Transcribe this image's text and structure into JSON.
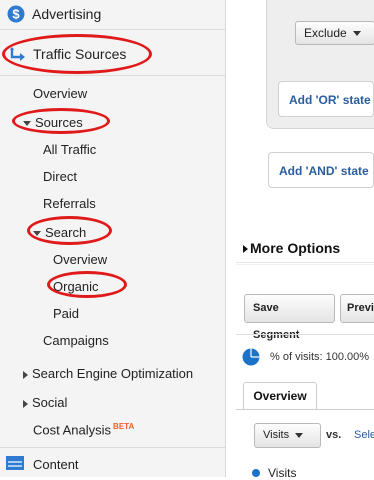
{
  "sidebar": {
    "advertising": "Advertising",
    "traffic_sources": "Traffic Sources",
    "overview": "Overview",
    "sources": "Sources",
    "all_traffic": "All Traffic",
    "direct": "Direct",
    "referrals": "Referrals",
    "search": "Search",
    "search_overview": "Overview",
    "organic": "Organic",
    "paid": "Paid",
    "campaigns": "Campaigns",
    "seo": "Search Engine Optimization",
    "social": "Social",
    "cost_analysis": "Cost Analysis",
    "beta": "BETA",
    "content": "Content"
  },
  "segment": {
    "exclude": "Exclude",
    "add_or": "Add 'OR' state",
    "add_and": "Add 'AND' state",
    "more_options": "More Options",
    "save_segment": "Save Segment",
    "preview": "Previ"
  },
  "report": {
    "percent_visits": "% of visits: 100.00%",
    "overview_tab": "Overview",
    "metric": "Visits",
    "vs": "vs.",
    "select": "Sele",
    "legend_visits": "Visits"
  },
  "colors": {
    "link": "#2a5d9e",
    "annotation": "#e01a1a",
    "accent": "#1a73c9"
  }
}
